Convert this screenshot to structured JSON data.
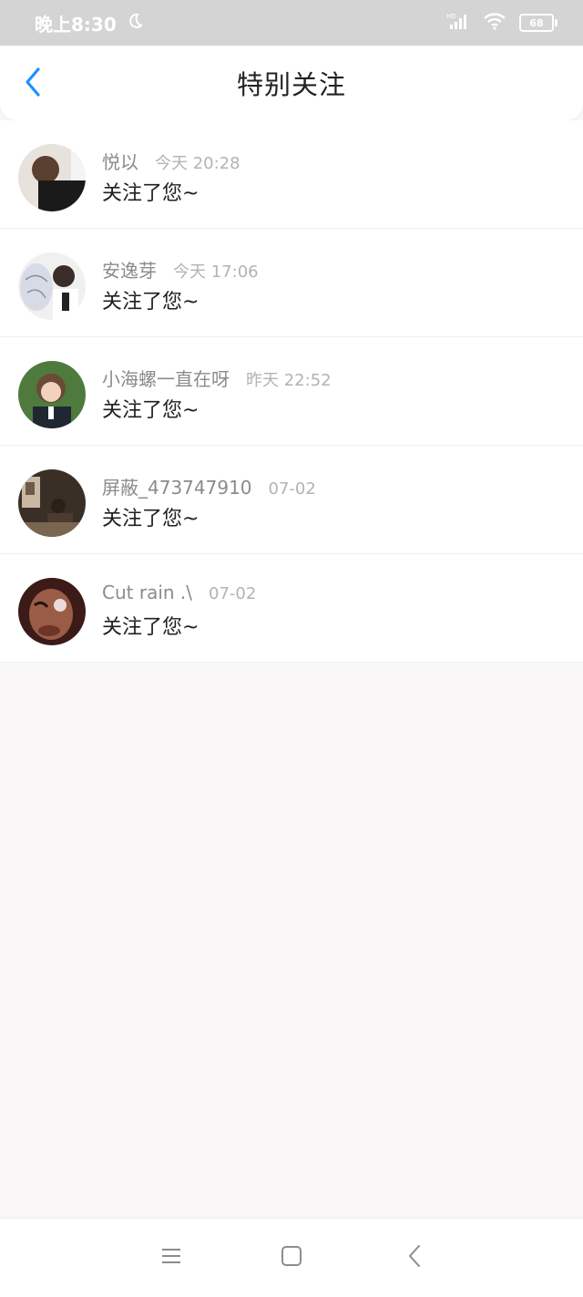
{
  "status_bar": {
    "time": "晚上8:30",
    "battery": "68"
  },
  "header": {
    "title": "特别关注"
  },
  "notifications": [
    {
      "name": "悦以",
      "time": "今天 20:28",
      "message": "关注了您~"
    },
    {
      "name": "安逸芽",
      "time": "今天 17:06",
      "message": "关注了您~"
    },
    {
      "name": "小海螺一直在呀",
      "time": "昨天 22:52",
      "message": "关注了您~"
    },
    {
      "name": "屏蔽_473747910",
      "time": "07-02",
      "message": "关注了您~"
    },
    {
      "name": "Cut rain .\\",
      "time": "07-02",
      "message": "关注了您~"
    }
  ],
  "colors": {
    "accent": "#1e90ff",
    "status_bar_bg": "#d4d4d4",
    "page_bg": "#f9f7f8"
  }
}
